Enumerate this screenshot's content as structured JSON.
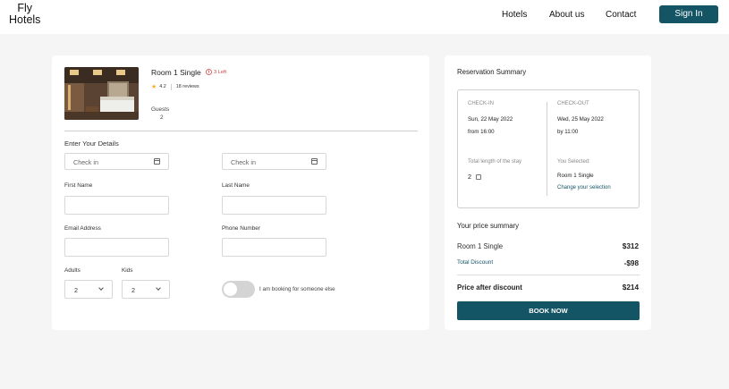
{
  "header": {
    "logo_line1": "Fly",
    "logo_line2": "Hotels",
    "nav": [
      "Hotels",
      "About us",
      "Contact"
    ],
    "signin_label": "Sign In"
  },
  "room": {
    "title": "Room 1 Single",
    "left_badge": "3 Left",
    "rating": "4.2",
    "reviews": "18 reviews",
    "guests_label": "Guests",
    "guests_value": "2"
  },
  "form": {
    "section_title": "Enter Your Details",
    "checkin_placeholder_1": "Check in",
    "checkin_placeholder_2": "Check in",
    "first_name_label": "First Name",
    "last_name_label": "Last Name",
    "email_label": "Email Address",
    "phone_label": "Phone Number",
    "adults_label": "Adults",
    "kids_label": "Kids",
    "adults_value": "2",
    "kids_value": "2",
    "toggle_label": "I am booking for someone else"
  },
  "summary": {
    "title": "Reservation Summary",
    "checkin_label": "CHECK-IN",
    "checkin_date": "Sun, 22 May 2022",
    "checkin_time": "from 16:00",
    "checkout_label": "CHECK-OUT",
    "checkout_date": "Wed, 25 May 2022",
    "checkout_time": "by 11:00",
    "length_label": "Total length of the stay",
    "length_value": "2",
    "selected_label": "You Selected:",
    "selected_room": "Room 1 Single",
    "change_link": "Change your selection"
  },
  "price": {
    "title": "Your price summary",
    "room_label": "Room 1 Single",
    "room_price": "$312",
    "discount_label": "Total Discount",
    "discount_value": "-$98",
    "after_label": "Price after discount",
    "after_value": "$214",
    "book_label": "BOOK NOW"
  },
  "colors": {
    "accent": "#135565",
    "warning": "#d63b3b",
    "star": "#f0b429"
  }
}
